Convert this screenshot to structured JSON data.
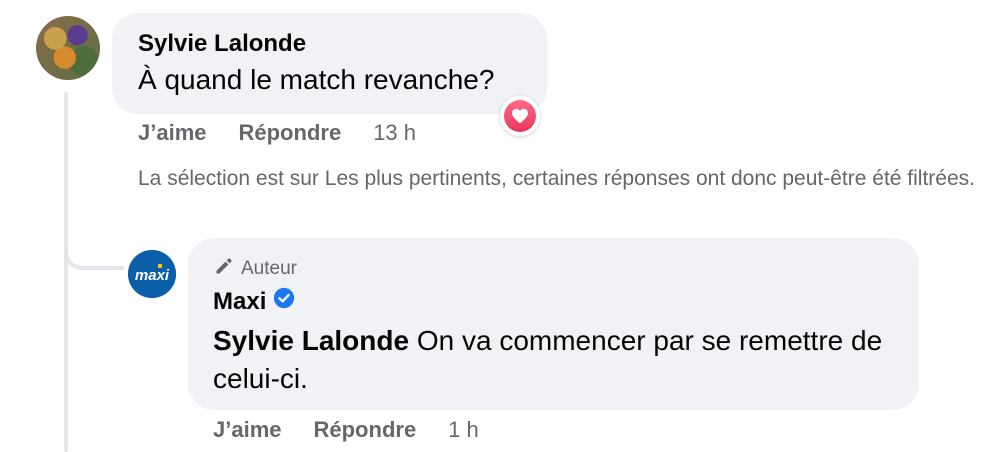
{
  "comment": {
    "author": "Sylvie Lalonde",
    "text": "À quand le match revanche?",
    "reaction_icon": "heart-icon",
    "actions": {
      "like": "J’aime",
      "reply": "Répondre",
      "time": "13 h"
    }
  },
  "filter_notice": "La sélection est sur Les plus pertinents, certaines réponses ont donc peut-être été filtrées.",
  "reply": {
    "badge": "Auteur",
    "badge_icon": "pencil-icon",
    "author": "Maxi",
    "avatar_text": "maxi",
    "verified_icon": "verified-check-icon",
    "mention": "Sylvie Lalonde",
    "text": " On va commencer par se remettre de celui-ci.",
    "actions": {
      "like": "J’aime",
      "reply": "Répondre",
      "time": "1 h"
    }
  },
  "colors": {
    "bubble": "#f0f2f5",
    "secondary_text": "#65676b",
    "verified": "#1877f2",
    "heart": "#e8365d",
    "maxi_blue": "#0b5fa8"
  }
}
